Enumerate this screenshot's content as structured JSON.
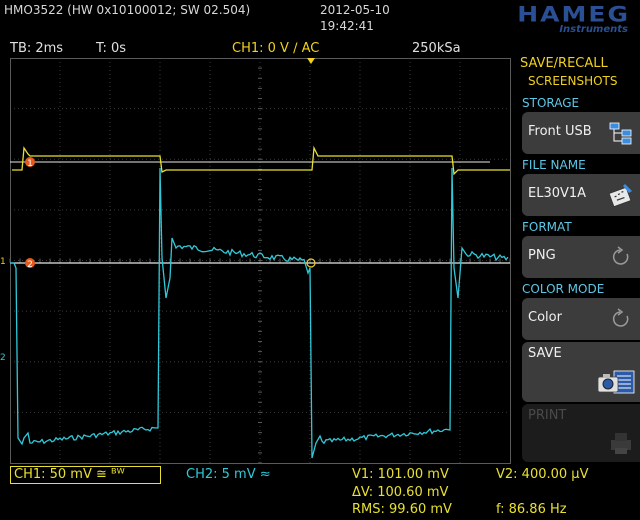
{
  "header": {
    "model": "HMO3522 (HW 0x10100012; SW 02.504)",
    "date": "2012-05-10",
    "time": "19:42:41",
    "logo": "HAMEG",
    "logo_sub": "Instruments"
  },
  "info": {
    "timebase": "TB: 2ms",
    "trigger_time": "T: 0s",
    "trigger": "CH1: 0 V ∕ AC",
    "sample_rate": "250kSa"
  },
  "menu": {
    "title_line1": "SAVE/RECALL",
    "title_line2": "SCREENSHOTS",
    "storage_label": "STORAGE",
    "storage_value": "Front USB",
    "file_name_label": "FILE NAME",
    "file_name_value": "EL30V1A",
    "format_label": "FORMAT",
    "format_value": "PNG",
    "color_mode_label": "COLOR MODE",
    "color_mode_value": "Color",
    "save_label": "SAVE",
    "print_label": "PRINT"
  },
  "channels": {
    "ch1": "CH1: 50 mV ≅ ᴮᵂ",
    "ch2": "CH2: 5 mV ≈",
    "ch1_marker": "1",
    "ch2_marker": "2"
  },
  "measurements": {
    "v1": "V1: 101.00 mV",
    "v2": "V2: 400.00 µV",
    "delta_v": "ΔV: 100.60 mV",
    "rms": "RMS: 99.60 mV",
    "freq": "f: 86.86 Hz"
  },
  "colors": {
    "ch1": "#e8e030",
    "ch2": "#30c8d8",
    "accent": "#f0d020",
    "menu_head": "#5cc7e6"
  }
}
